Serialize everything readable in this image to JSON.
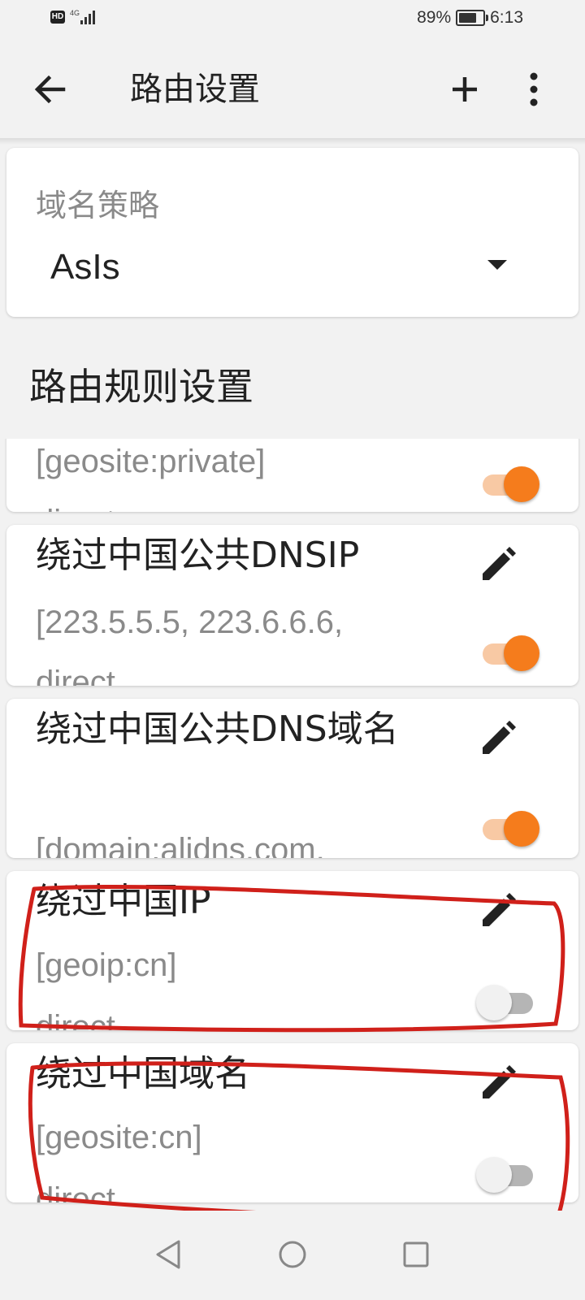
{
  "status_bar": {
    "hd": "HD",
    "network": "4G",
    "battery_percent": "89%",
    "battery_level": 0.89,
    "time": "6:13"
  },
  "toolbar": {
    "title": "路由设置",
    "back_icon": "arrow-left-icon",
    "add_icon": "plus-icon",
    "more_icon": "more-vert-icon"
  },
  "domain_strategy": {
    "label": "域名策略",
    "value": "AsIs"
  },
  "rules_section": {
    "title": "路由规则设置"
  },
  "rules": [
    {
      "title": "",
      "detail": "[geosite:private]",
      "target": "direct",
      "enabled": true,
      "has_edit": false
    },
    {
      "title": "绕过中国公共DNSIP",
      "detail": "[223.5.5.5, 223.6.6.6,",
      "target": "direct",
      "enabled": true,
      "has_edit": true
    },
    {
      "title": "绕过中国公共DNS域名",
      "detail": "[domain:alidns.com,",
      "target": "",
      "enabled": true,
      "has_edit": true
    },
    {
      "title": "绕过中国IP",
      "detail": "[geoip:cn]",
      "target": "direct",
      "enabled": false,
      "has_edit": true
    },
    {
      "title": "绕过中国域名",
      "detail": "[geosite:cn]",
      "target": "direct",
      "enabled": false,
      "has_edit": true
    }
  ],
  "colors": {
    "accent": "#f57c1c",
    "accent_light": "#f8c9a4",
    "annotation": "#d0201a",
    "background": "#f2f2f2"
  },
  "nav_bar": {
    "back_icon": "nav-back-icon",
    "home_icon": "nav-home-icon",
    "recents_icon": "nav-recents-icon"
  }
}
